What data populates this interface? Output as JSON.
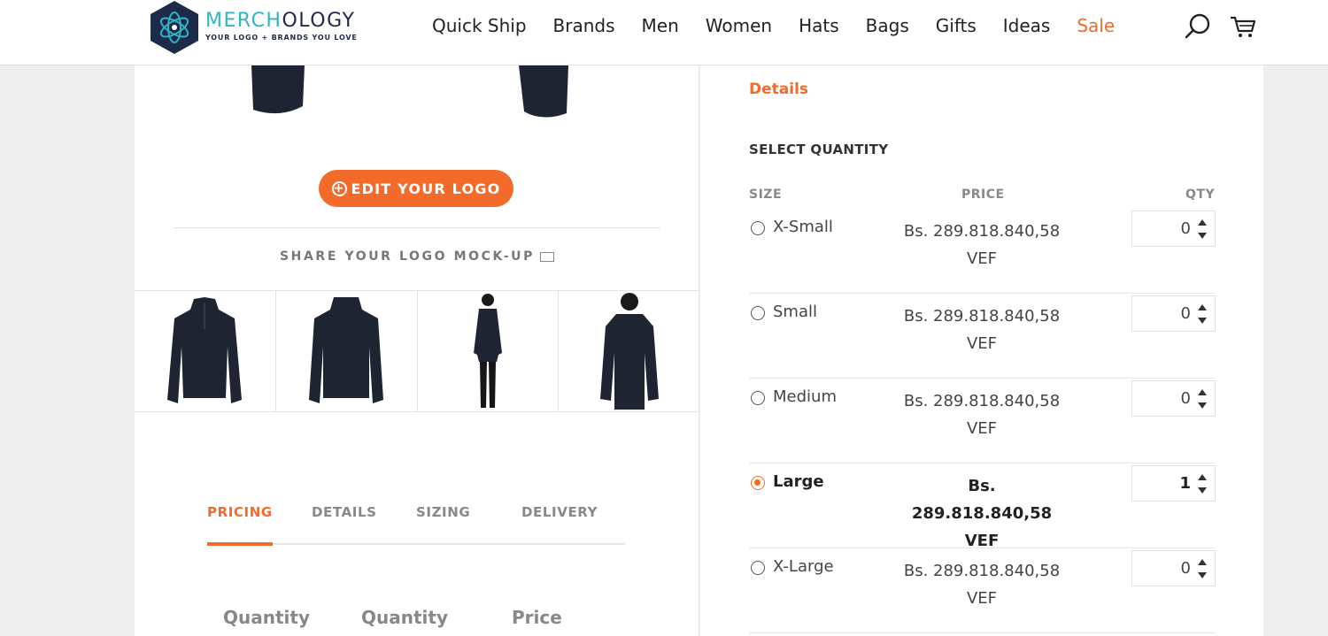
{
  "header": {
    "logo_word_a": "MERCH",
    "logo_word_b": "OLOGY",
    "logo_tagline": "YOUR LOGO + BRANDS YOU LOVE",
    "nav": [
      "Quick Ship",
      "Brands",
      "Men",
      "Women",
      "Hats",
      "Bags",
      "Gifts",
      "Ideas",
      "Sale"
    ],
    "search_icon": "search-icon",
    "cart_icon": "cart-icon"
  },
  "left": {
    "edit_button": "EDIT YOUR LOGO",
    "share_text": "SHARE YOUR LOGO MOCK-UP",
    "thumbnails": [
      "jacket-front",
      "jacket-back",
      "model-front",
      "model-back"
    ],
    "tabs": [
      "PRICING",
      "DETAILS",
      "SIZING",
      "DELIVERY"
    ],
    "active_tab": "PRICING",
    "pricing_columns": [
      "Quantity",
      "Quantity",
      "Price"
    ]
  },
  "right": {
    "details_link": "Details",
    "select_quantity": "SELECT QUANTITY",
    "columns": {
      "size": "SIZE",
      "price": "PRICE",
      "qty": "QTY"
    },
    "sizes": [
      {
        "size": "X-Small",
        "price_line1": "Bs. 289.818.840,58",
        "price_line2": "VEF",
        "qty": "0",
        "selected": false
      },
      {
        "size": "Small",
        "price_line1": "Bs. 289.818.840,58",
        "price_line2": "VEF",
        "qty": "0",
        "selected": false
      },
      {
        "size": "Medium",
        "price_line1": "Bs. 289.818.840,58",
        "price_line2": "VEF",
        "qty": "0",
        "selected": false
      },
      {
        "size": "Large",
        "price_line1": "Bs. 289.818.840,58",
        "price_line2": "VEF",
        "qty": "1",
        "selected": true
      },
      {
        "size": "X-Large",
        "price_line1": "Bs. 289.818.840,58",
        "price_line2": "VEF",
        "qty": "0",
        "selected": false
      }
    ]
  },
  "colors": {
    "accent": "#f26b2a",
    "logo_teal": "#2fb5c4",
    "logo_navy": "#1d2a4a"
  }
}
